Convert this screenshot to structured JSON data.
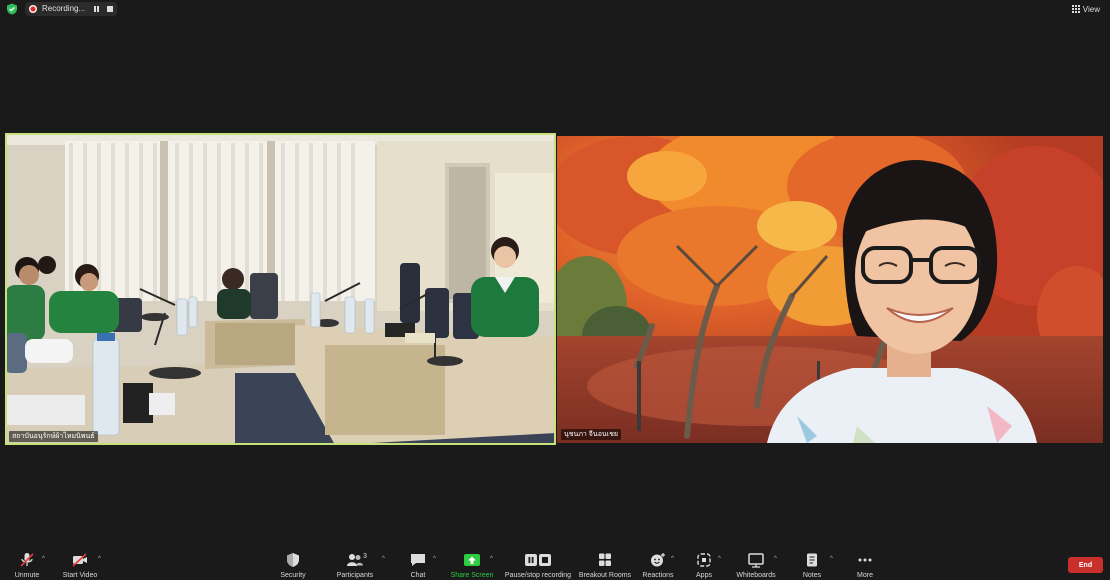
{
  "recording": {
    "label": "Recording..."
  },
  "view": {
    "label": "View"
  },
  "tiles": [
    {
      "name": "สถาบันอนุรักษ์ผ้าไหมนิพนธ์"
    },
    {
      "name": "นุชนภา จีนอนเชย"
    }
  ],
  "toolbar": {
    "unmute": "Unmute",
    "start_video": "Start Video",
    "security": "Security",
    "participants": "Participants",
    "participants_count": "3",
    "chat": "Chat",
    "share_screen": "Share Screen",
    "pause_recording": "Pause/stop recording",
    "breakout_rooms": "Breakout Rooms",
    "reactions": "Reactions",
    "apps": "Apps",
    "whiteboards": "Whiteboards",
    "notes": "Notes",
    "more": "More",
    "end": "End"
  },
  "colors": {
    "background": "#1a1a1a",
    "active_speaker_border": "#c6e07a",
    "share_green": "#2ecc40",
    "end_red": "#c9302c",
    "record_red": "#e02828"
  }
}
